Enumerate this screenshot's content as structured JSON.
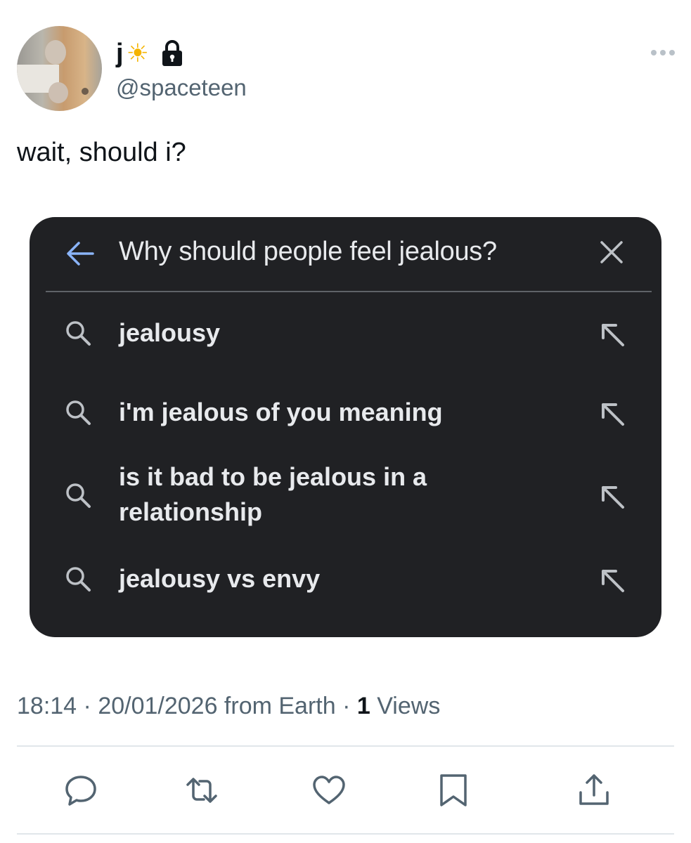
{
  "author": {
    "name": "j",
    "name_emoji": "☀",
    "handle": "@spaceteen",
    "protected": true
  },
  "tweet": {
    "text": "wait, should i?"
  },
  "search_card": {
    "query": "Why should people feel jealous?",
    "suggestions": [
      {
        "label": "jealousy"
      },
      {
        "label": "i'm jealous of you meaning"
      },
      {
        "label": "is it bad to be jealous in a relationship"
      },
      {
        "label": "jealousy vs envy"
      }
    ]
  },
  "meta": {
    "time": "18:14",
    "sep1": " · ",
    "date": "20/01/2026",
    "source": " from Earth",
    "sep2": " · ",
    "views_count": "1",
    "views_label": " Views"
  },
  "icons": {
    "reply": "reply-icon",
    "retweet": "retweet-icon",
    "like": "like-icon",
    "bookmark": "bookmark-icon",
    "share": "share-icon"
  },
  "colors": {
    "card_bg": "#202124",
    "accent_blue": "#8ab4f8",
    "muted": "#536471"
  }
}
